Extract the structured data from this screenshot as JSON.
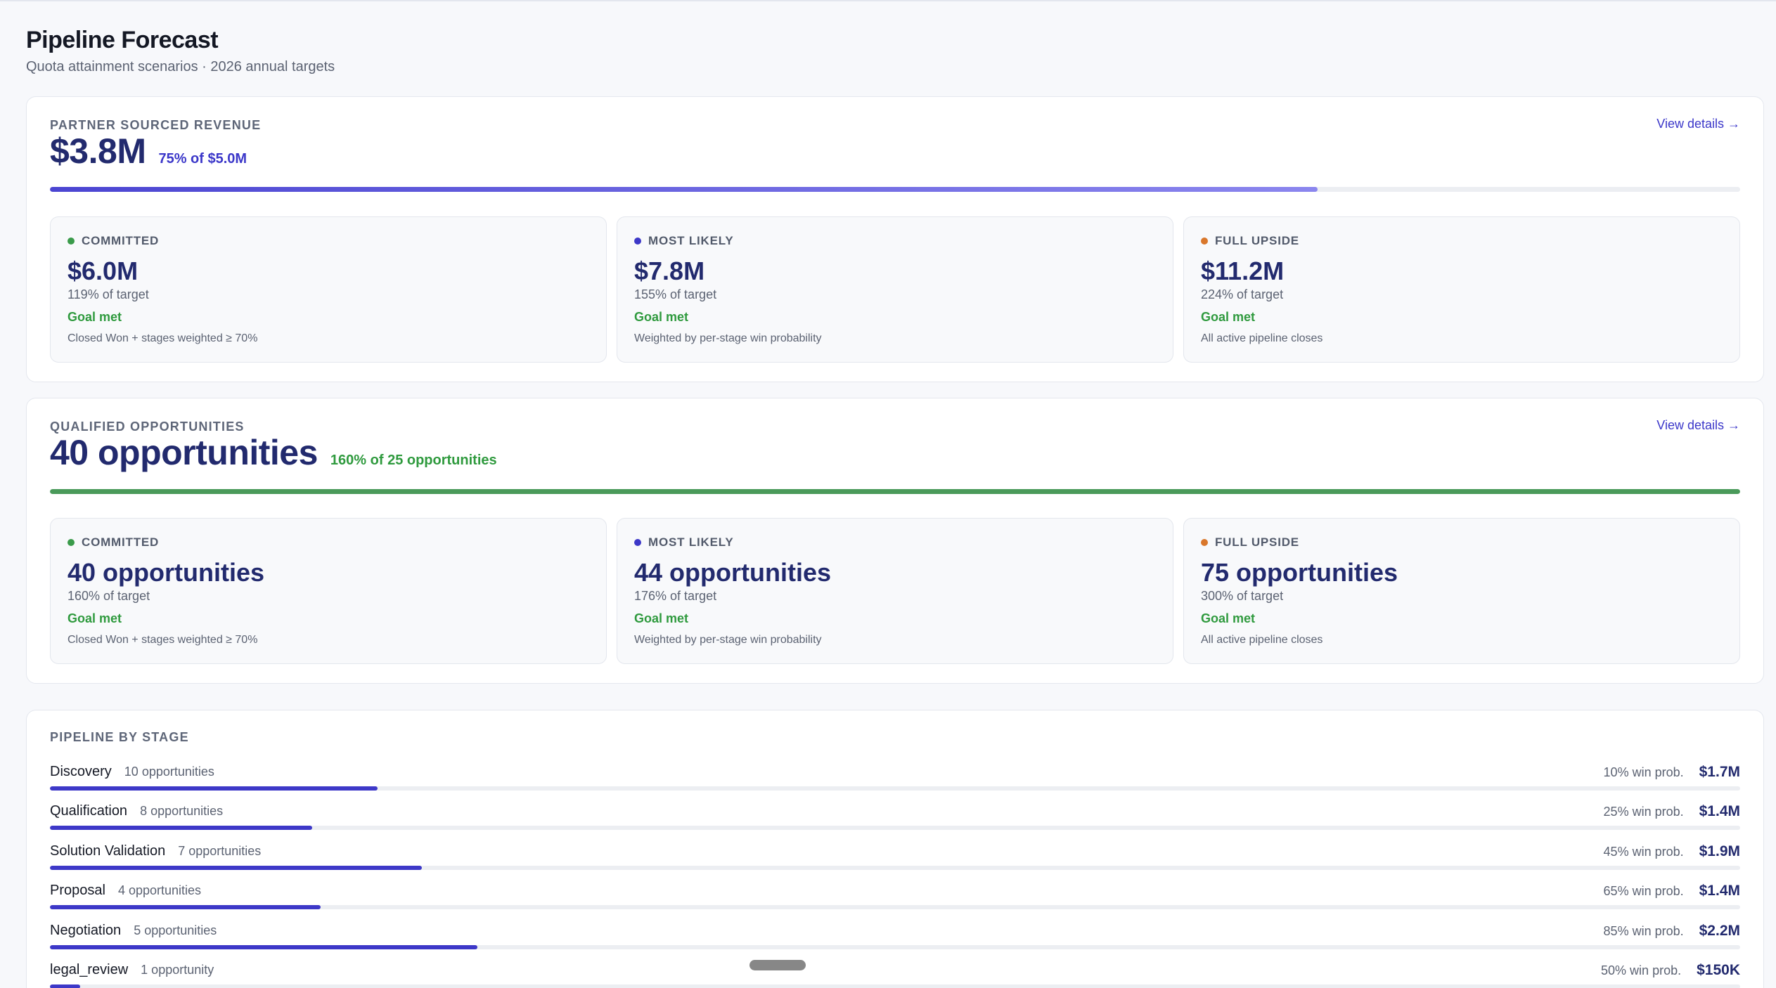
{
  "header": {
    "title": "Pipeline Forecast",
    "subtitle": "Quota attainment scenarios · 2026 annual targets"
  },
  "revenue": {
    "label": "PARTNER SOURCED REVENUE",
    "link": "View details →",
    "value": "$3.8M",
    "sub": "75% of $5.0M",
    "progress": 0.75,
    "scenarios": [
      {
        "label": "COMMITTED",
        "value": "$6.0M",
        "pct": "119% of target",
        "goal": "Goal met",
        "note": "Closed Won + stages weighted ≥ 70%",
        "color": "#3a9b4a"
      },
      {
        "label": "MOST LIKELY",
        "value": "$7.8M",
        "pct": "155% of target",
        "goal": "Goal met",
        "note": "Weighted by per-stage win probability",
        "color": "#3d38c8"
      },
      {
        "label": "FULL UPSIDE",
        "value": "$11.2M",
        "pct": "224% of target",
        "goal": "Goal met",
        "note": "All active pipeline closes",
        "color": "#d9772b"
      }
    ]
  },
  "opportunities": {
    "label": "QUALIFIED OPPORTUNITIES",
    "link": "View details →",
    "value": "40 opportunities",
    "sub": "160% of 25 opportunities",
    "progress": 1.0,
    "scenarios": [
      {
        "label": "COMMITTED",
        "value": "40 opportunities",
        "pct": "160% of target",
        "goal": "Goal met",
        "note": "Closed Won + stages weighted ≥ 70%",
        "color": "#3a9b4a"
      },
      {
        "label": "MOST LIKELY",
        "value": "44 opportunities",
        "pct": "176% of target",
        "goal": "Goal met",
        "note": "Weighted by per-stage win probability",
        "color": "#3d38c8"
      },
      {
        "label": "FULL UPSIDE",
        "value": "75 opportunities",
        "pct": "300% of target",
        "goal": "Goal met",
        "note": "All active pipeline closes",
        "color": "#d9772b"
      }
    ]
  },
  "stages": {
    "title": "PIPELINE BY STAGE",
    "rows": [
      {
        "name": "Discovery",
        "count": "10 opportunities",
        "prob": "10% win prob.",
        "amount": "$1.7M",
        "share": 0.194
      },
      {
        "name": "Qualification",
        "count": "8 opportunities",
        "prob": "25% win prob.",
        "amount": "$1.4M",
        "share": 0.155
      },
      {
        "name": "Solution Validation",
        "count": "7 opportunities",
        "prob": "45% win prob.",
        "amount": "$1.9M",
        "share": 0.22
      },
      {
        "name": "Proposal",
        "count": "4 opportunities",
        "prob": "65% win prob.",
        "amount": "$1.4M",
        "share": 0.16
      },
      {
        "name": "Negotiation",
        "count": "5 opportunities",
        "prob": "85% win prob.",
        "amount": "$2.2M",
        "share": 0.253
      },
      {
        "name": "legal_review",
        "count": "1 opportunity",
        "prob": "50% win prob.",
        "amount": "$150K",
        "share": 0.018
      }
    ]
  },
  "colors": {
    "accent": "#3d38c8",
    "revenue_bar_start": "#4b45d2",
    "revenue_bar_end": "#8b86ee",
    "opps_bar": "#4a9a5a",
    "goal": "#2f9a3e",
    "revenue_sub": "#3b37c9",
    "opps_sub": "#2f9a3e"
  }
}
